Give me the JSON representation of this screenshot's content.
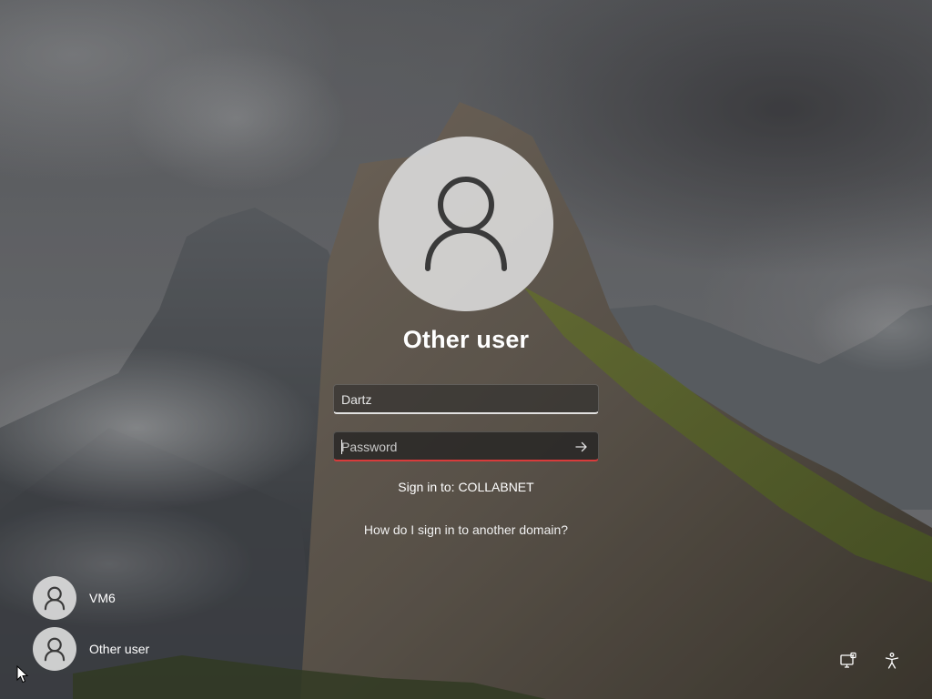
{
  "lock_screen": {
    "selected_user": {
      "name": "Other user",
      "avatar_icon": "person-icon"
    },
    "username_field": {
      "value": "Dartz"
    },
    "password_field": {
      "placeholder": "Password",
      "value": "",
      "submit_icon": "arrow-right-icon",
      "underline_color": "#d83b3b"
    },
    "sign_in_to": "Sign in to: COLLABNET",
    "other_domain_link": "How do I sign in to another domain?"
  },
  "user_list": [
    {
      "name": "VM6",
      "avatar_icon": "person-icon"
    },
    {
      "name": "Other user",
      "avatar_icon": "person-icon"
    }
  ],
  "corner_controls": [
    {
      "icon": "network-icon"
    },
    {
      "icon": "accessibility-icon"
    }
  ]
}
